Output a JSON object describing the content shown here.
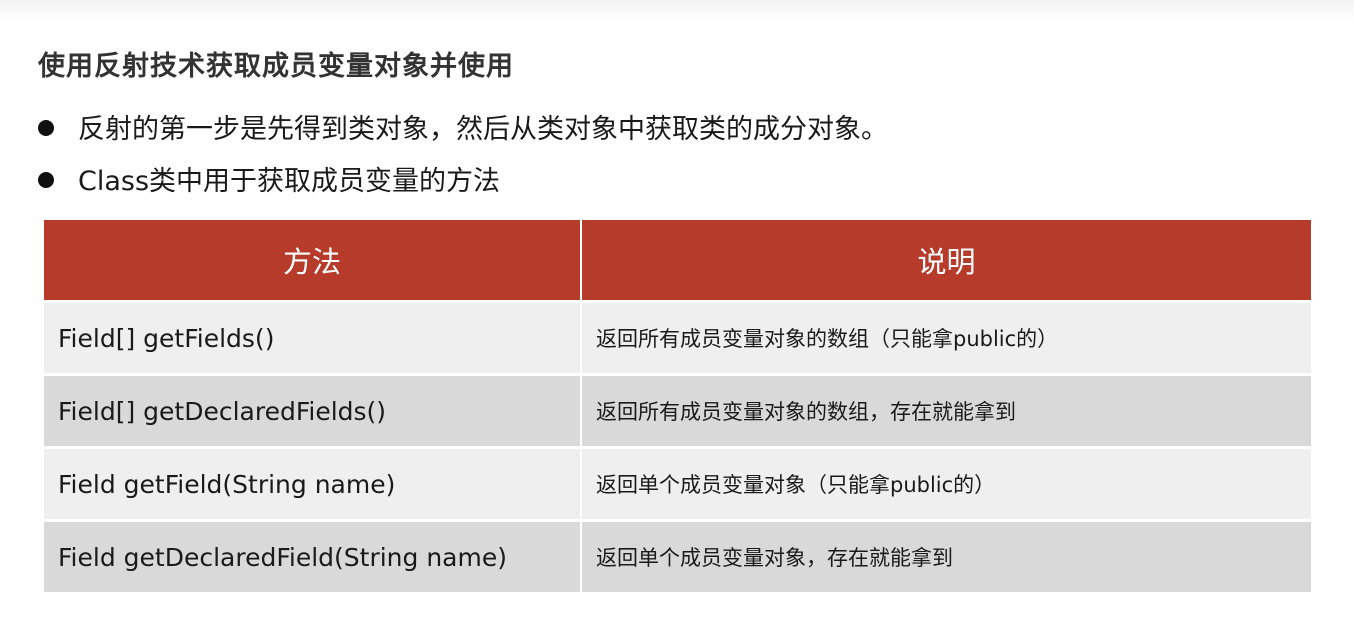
{
  "slide": {
    "title": "使用反射技术获取成员变量对象并使用",
    "bullets": [
      "反射的第一步是先得到类对象，然后从类对象中获取类的成分对象。",
      "Class类中用于获取成员变量的方法"
    ]
  },
  "table": {
    "headers": [
      "方法",
      "说明"
    ],
    "rows": [
      {
        "method": "Field[] getFields()",
        "description": "返回所有成员变量对象的数组（只能拿public的）"
      },
      {
        "method": "Field[] getDeclaredFields()",
        "description": "返回所有成员变量对象的数组，存在就能拿到"
      },
      {
        "method": "Field getField(String name)",
        "description": "返回单个成员变量对象（只能拿public的）"
      },
      {
        "method": "Field getDeclaredField(String name)",
        "description": "返回单个成员变量对象，存在就能拿到"
      }
    ]
  },
  "colors": {
    "header_bg": "#b63b2b",
    "row_light": "#efefef",
    "row_dark": "#d9d9d9"
  }
}
